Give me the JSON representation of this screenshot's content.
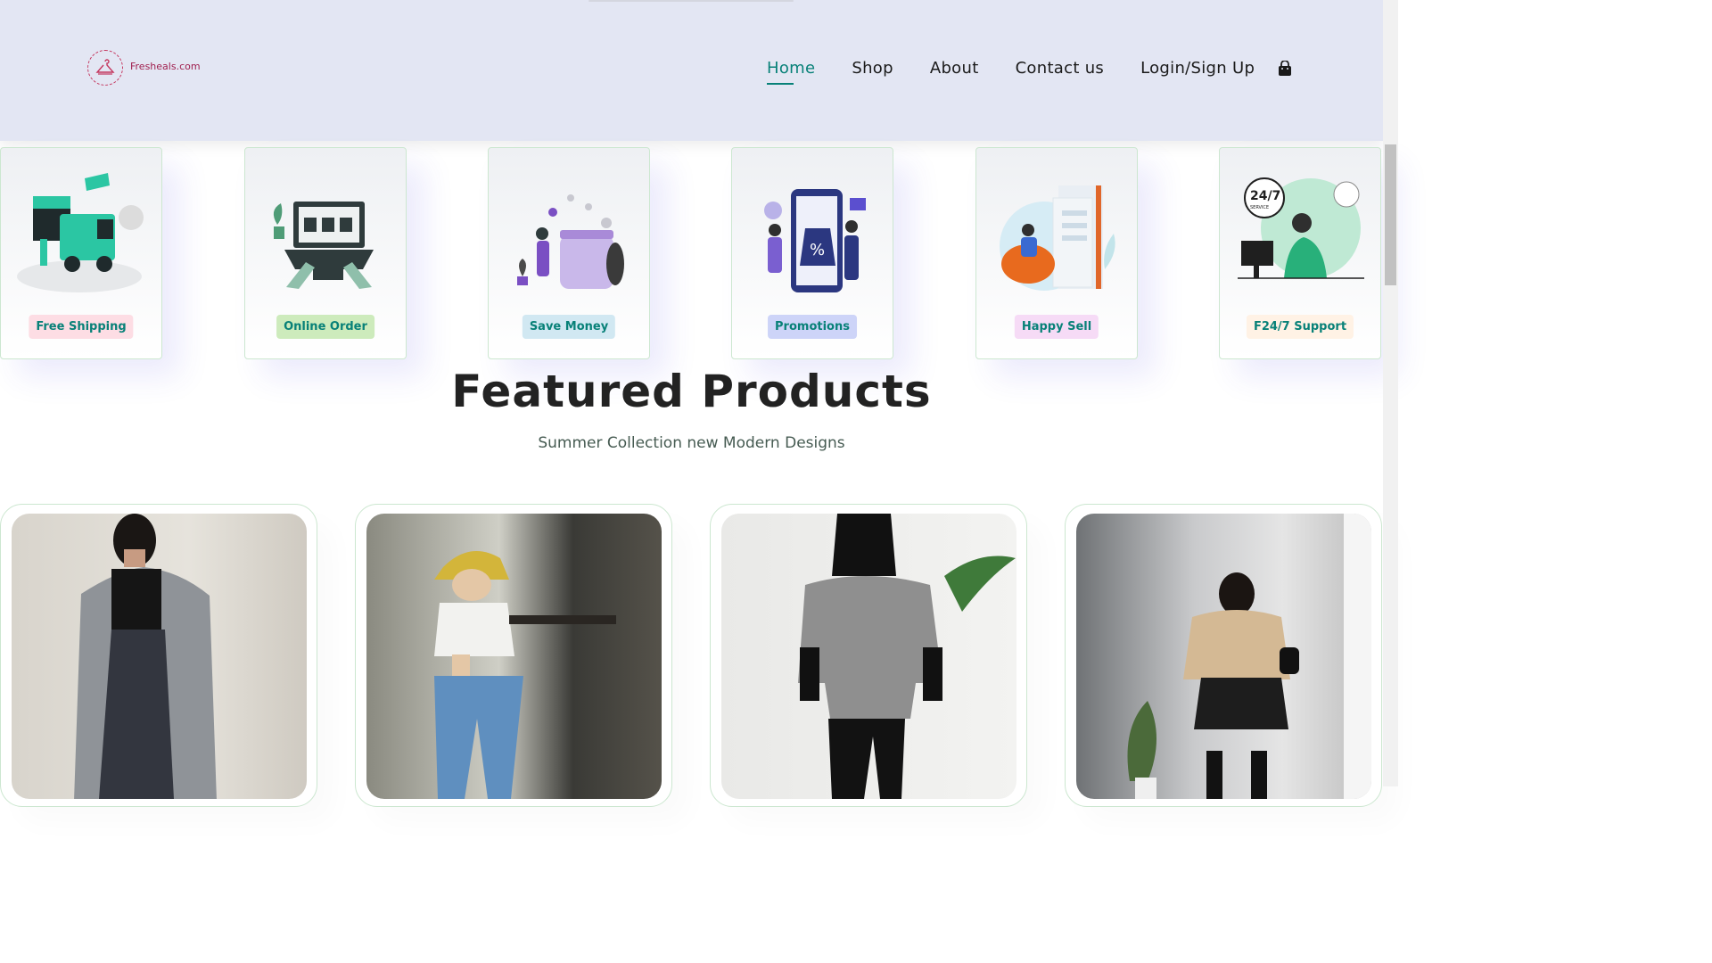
{
  "brand": {
    "logo_text": "Fresheals.com"
  },
  "nav": {
    "items": [
      {
        "label": "Home",
        "active": true
      },
      {
        "label": "Shop",
        "active": false
      },
      {
        "label": "About",
        "active": false
      },
      {
        "label": "Contact us",
        "active": false
      },
      {
        "label": "Login/Sign Up",
        "active": false
      }
    ],
    "cart_icon": "shopping-bag-icon"
  },
  "features": [
    {
      "label": "Free Shipping",
      "tag_bg": "#fddde4",
      "illustration": "delivery-truck"
    },
    {
      "label": "Online Order",
      "tag_bg": "#cdebbc",
      "illustration": "laptop-shopping"
    },
    {
      "label": "Save Money",
      "tag_bg": "#d1e8f2",
      "illustration": "savings-jar"
    },
    {
      "label": "Promotions",
      "tag_bg": "#cdd4f8",
      "illustration": "phone-promotion"
    },
    {
      "label": "Happy Sell",
      "tag_bg": "#f6dbf6",
      "illustration": "reading-chair"
    },
    {
      "label": "F24/7 Support",
      "tag_bg": "#fff2e5",
      "illustration": "support-agent"
    }
  ],
  "featured": {
    "title": "Featured Products",
    "subtitle": "Summer Collection new Modern Designs"
  },
  "products": [
    {
      "image": "woman-grey-coat"
    },
    {
      "image": "woman-bucket-hat"
    },
    {
      "image": "woman-grey-sweatshirt"
    },
    {
      "image": "woman-beige-sweater"
    }
  ],
  "colors": {
    "accent": "#088178",
    "header_bg": "#e3e6f3",
    "border": "#cce7d0"
  }
}
